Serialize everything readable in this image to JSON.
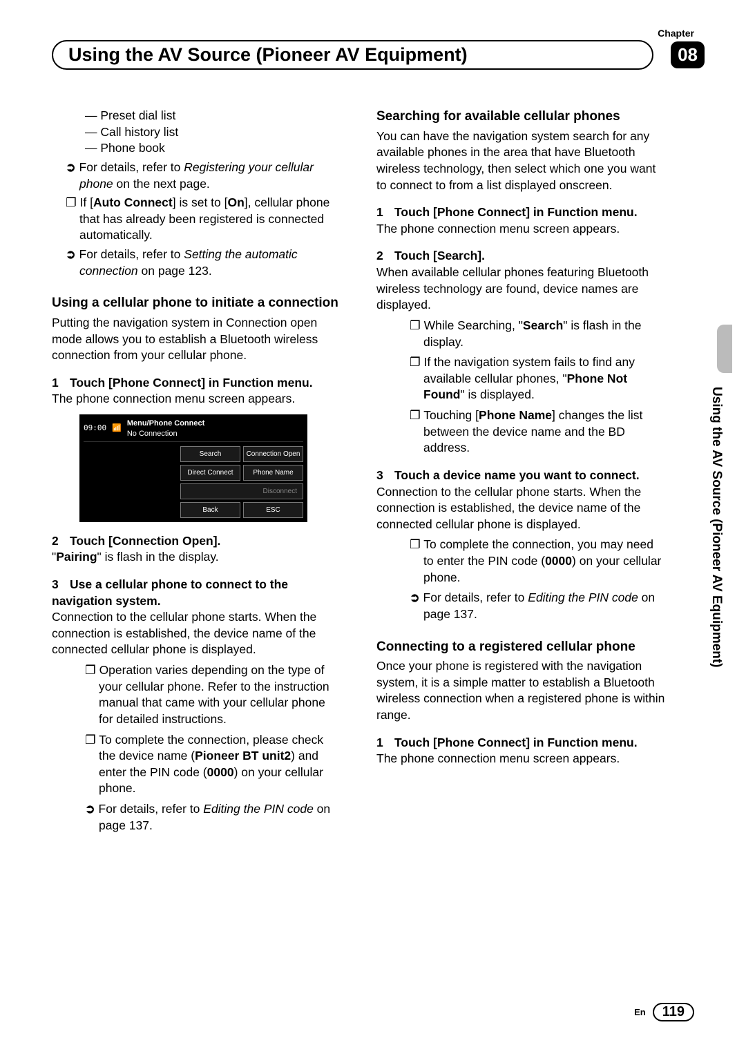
{
  "meta": {
    "chapter_label": "Chapter",
    "chapter_num": "08",
    "title": "Using the AV Source (Pioneer AV Equipment)",
    "side_tab": "Using the AV Source (Pioneer AV Equipment)",
    "lang": "En",
    "page_num": "119"
  },
  "left": {
    "dash_items": [
      "Preset dial list",
      "Call history list",
      "Phone book"
    ],
    "icon1_pre": "For details, refer to ",
    "icon1_em": "Registering your cellular phone",
    "icon1_post": " on the next page.",
    "icon2_pre": "If [",
    "icon2_b1": "Auto Connect",
    "icon2_mid": "] is set to [",
    "icon2_b2": "On",
    "icon2_post": "], cellular phone that has already been registered is connected automatically.",
    "icon3_pre": "For details, refer to ",
    "icon3_em": "Setting the automatic connection",
    "icon3_post": " on page 123.",
    "h1": "Using a cellular phone to initiate a connection",
    "p1": "Putting the navigation system in Connection open mode allows you to establish a Bluetooth wireless connection from your cellular phone.",
    "step1": "Touch [Phone Connect] in Function menu.",
    "step1_body": "The phone connection menu screen appears.",
    "screenshot": {
      "time": "09:00",
      "menu_path": "Menu/Phone Connect",
      "status": "No Connection",
      "btns": [
        "Search",
        "Connection Open",
        "Direct Connect",
        "Phone Name"
      ],
      "disconnect": "Disconnect",
      "back": "Back",
      "esc": "ESC"
    },
    "step2": "Touch [Connection Open].",
    "step2_body_pre": "\"",
    "step2_body_b": "Pairing",
    "step2_body_post": "\" is flash in the display.",
    "step3": "Use a cellular phone to connect to the navigation system.",
    "step3_body": "Connection to the cellular phone starts. When the connection is established, the device name of the connected cellular phone is displayed.",
    "sub1": "Operation varies depending on the type of your cellular phone. Refer to the instruction manual that came with your cellular phone for detailed instructions.",
    "sub2_pre": "To complete the connection, please check the device name (",
    "sub2_b1": "Pioneer BT unit2",
    "sub2_mid": ") and enter the PIN code (",
    "sub2_b2": "0000",
    "sub2_post": ") on your cellular phone.",
    "sub3_pre": "For details, refer to ",
    "sub3_em": "Editing the PIN code",
    "sub3_post": " on page 137."
  },
  "right": {
    "h1": "Searching for available cellular phones",
    "p1": "You can have the navigation system search for any available phones in the area that have Bluetooth wireless technology, then select which one you want to connect to from a list displayed onscreen.",
    "step1": "Touch [Phone Connect] in Function menu.",
    "step1_body": "The phone connection menu screen appears.",
    "step2": "Touch [Search].",
    "step2_body": "When available cellular phones featuring Bluetooth wireless technology are found, device names are displayed.",
    "sub1_pre": "While Searching, \"",
    "sub1_b": "Search",
    "sub1_post": "\" is flash in the display.",
    "sub2_pre": "If the navigation system fails to find any available cellular phones, \"",
    "sub2_b": "Phone Not Found",
    "sub2_post": "\" is displayed.",
    "sub3_pre": "Touching [",
    "sub3_b": "Phone Name",
    "sub3_post": "] changes the list between the device name and the BD address.",
    "step3": "Touch a device name you want to connect.",
    "step3_body": "Connection to the cellular phone starts. When the connection is established, the device name of the connected cellular phone is displayed.",
    "sub4_pre": "To complete the connection, you may need to enter the PIN code (",
    "sub4_b": "0000",
    "sub4_post": ") on your cellular phone.",
    "sub5_pre": "For details, refer to ",
    "sub5_em": "Editing the PIN code",
    "sub5_post": " on page 137.",
    "h2": "Connecting to a registered cellular phone",
    "p2": "Once your phone is registered with the navigation system, it is a simple matter to establish a Bluetooth wireless connection when a registered phone is within range.",
    "step4": "Touch [Phone Connect] in Function menu.",
    "step4_body": "The phone connection menu screen appears."
  }
}
